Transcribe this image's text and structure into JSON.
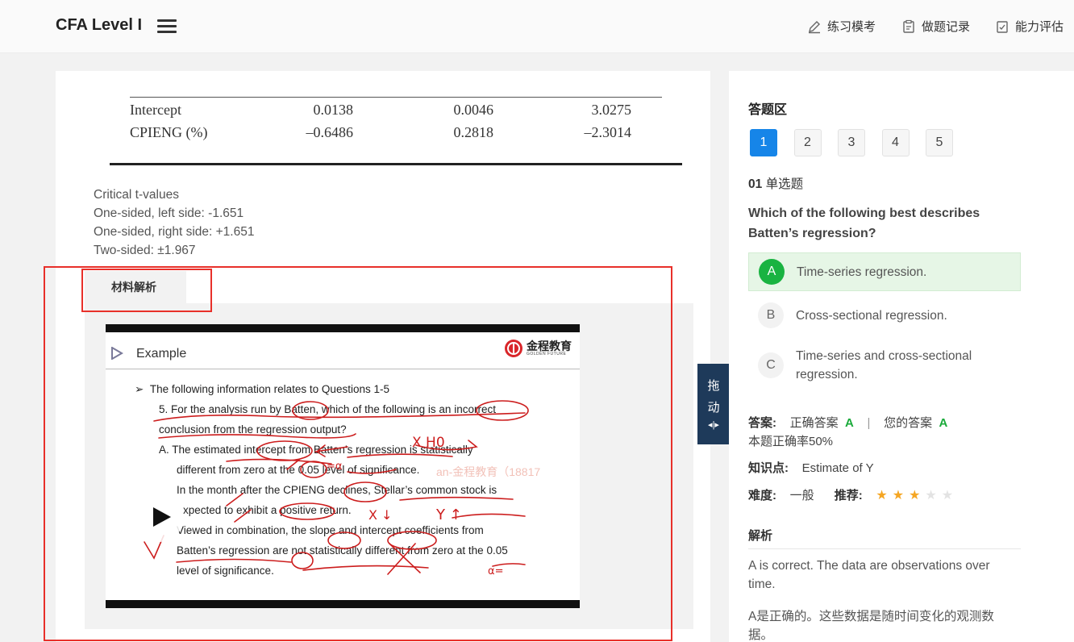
{
  "header": {
    "title": "CFA Level I",
    "nav": [
      {
        "label": "练习模考",
        "icon": "edit-icon"
      },
      {
        "label": "做题记录",
        "icon": "clipboard-icon"
      },
      {
        "label": "能力评估",
        "icon": "checklist-icon"
      }
    ]
  },
  "regression_table": {
    "rows": [
      [
        "Intercept",
        "0.0138",
        "0.0046",
        "3.0275"
      ],
      [
        "CPIENG (%)",
        "–0.6486",
        "0.2818",
        "–2.3014"
      ]
    ]
  },
  "critical_values": [
    "Critical t-values",
    "One-sided, left side: -1.651",
    "One-sided, right side: +1.651",
    "Two-sided: ±1.967"
  ],
  "material": {
    "tab_label": "材料解析",
    "slide": {
      "title": "Example",
      "logo_zh": "金程教育",
      "logo_en": "GOLDEN FUTURE",
      "watermark": "an-金程教育（18817",
      "lines": [
        "The following information relates to Questions 1-5",
        "5. For the analysis run by Batten, which of the following is an incorrect",
        "conclusion from the regression output?",
        "A.  The  estimated  intercept  from  Batten’s  regression  is  statistically",
        "different from zero at the 0.05 level of significance.",
        "In  the  month  after  the  CPIENG  declines,  Stellar’s  common  stock  is",
        "xpected to exhibit a positive return.",
        "Viewed  in  combination,  the  slope  and  intercept  coefficients  from",
        "Batten’s regression are not statistically different from zero at the 0.05",
        "level of significance."
      ],
      "handwriting": {
        "h0": "X H0",
        "alpha1": "=α",
        "x_down": "X ↓",
        "y_up": "Y ↑",
        "alpha2": "α="
      }
    }
  },
  "drag_handle": {
    "line1": "拖",
    "line2": "动",
    "icon": "resize-icon"
  },
  "answer_area": {
    "title": "答题区",
    "question_numbers": [
      "1",
      "2",
      "3",
      "4",
      "5"
    ],
    "active_question": "1",
    "question_index": "01",
    "question_type": "单选题",
    "question_text": "Which of the following best describes Batten’s regression?",
    "options": [
      {
        "letter": "A",
        "text": "Time-series regression.",
        "correct": true
      },
      {
        "letter": "B",
        "text": "Cross-sectional regression.",
        "correct": false
      },
      {
        "letter": "C",
        "text": "Time-series and cross-sectional regression.",
        "correct": false
      }
    ],
    "answer_label": "答案:",
    "correct_answer_label": "正确答案",
    "correct_answer": "A",
    "separator": "|",
    "your_answer_label": "您的答案",
    "your_answer": "A",
    "accuracy": "本题正确率50%",
    "knowledge_label": "知识点:",
    "knowledge_value": "Estimate of Y",
    "difficulty_label": "难度:",
    "difficulty_value": "一般",
    "recommend_label": "推荐:",
    "recommend_stars": 3,
    "recommend_max": 5,
    "analysis_label": "解析",
    "analysis_en": "A is correct. The data are observations over time.",
    "analysis_zh": "A是正确的。这些数据是随时间变化的观测数据。"
  },
  "colors": {
    "accent": "#1685e8",
    "correct_green": "#19b341",
    "annotation_red": "#e8302a",
    "drag_bg": "#1e3a5a",
    "star": "#f5a623"
  }
}
